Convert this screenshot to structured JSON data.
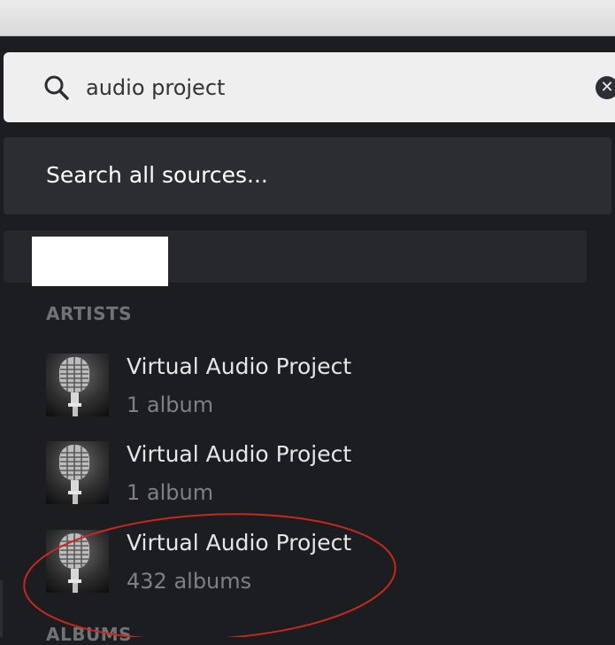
{
  "search": {
    "value": "audio project"
  },
  "search_all": {
    "label": "Search all sources..."
  },
  "sections": {
    "artists_header": "ARTISTS",
    "albums_header": "ALBUMS"
  },
  "artists": [
    {
      "name": "Virtual Audio Project",
      "count": "1 album",
      "icon": "microphone-icon"
    },
    {
      "name": "Virtual Audio Project",
      "count": "1 album",
      "icon": "microphone-icon"
    },
    {
      "name": "Virtual Audio Project",
      "count": "432 albums",
      "icon": "microphone-icon"
    }
  ],
  "colors": {
    "background": "#1b1d20",
    "search_box": "#efefef",
    "annotation": "#c8281e"
  }
}
